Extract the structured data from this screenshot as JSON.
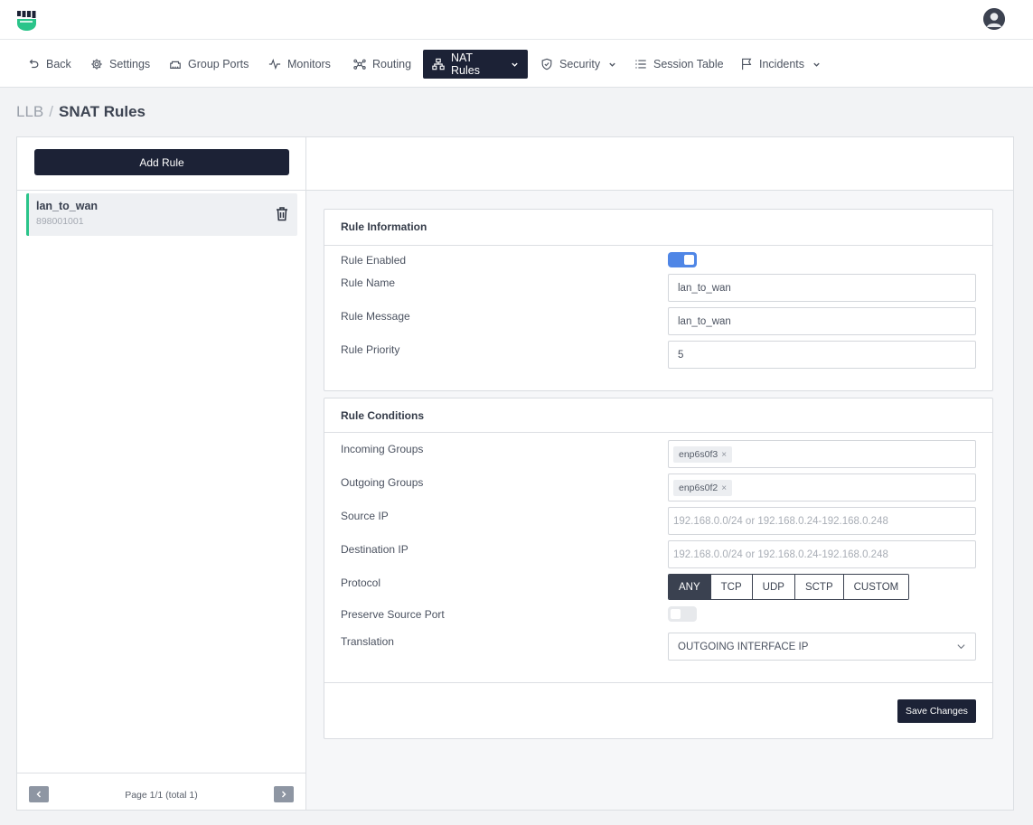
{
  "header": {
    "logo_icon": "fist-logo-icon",
    "avatar_icon": "user-avatar-icon"
  },
  "nav": {
    "back": "Back",
    "settings": "Settings",
    "group_ports": "Group Ports",
    "monitors": "Monitors",
    "routing": "Routing",
    "nat_rules": "NAT Rules",
    "security": "Security",
    "session_table": "Session Table",
    "incidents": "Incidents",
    "active": "NAT Rules"
  },
  "breadcrumb": {
    "root": "LLB",
    "separator": "/",
    "current": "SNAT Rules"
  },
  "sidebar": {
    "add_button": "Add Rule",
    "rules": [
      {
        "name": "lan_to_wan",
        "id": "898001001"
      }
    ],
    "pagination": {
      "text": "Page 1/1 (total 1)"
    }
  },
  "rule_info": {
    "title": "Rule Information",
    "enabled_label": "Rule Enabled",
    "enabled": true,
    "name_label": "Rule Name",
    "name_value": "lan_to_wan",
    "message_label": "Rule Message",
    "message_value": "lan_to_wan",
    "priority_label": "Rule Priority",
    "priority_value": "5"
  },
  "rule_conditions": {
    "title": "Rule Conditions",
    "incoming_label": "Incoming Groups",
    "incoming_tags": [
      "enp6s0f3"
    ],
    "outgoing_label": "Outgoing Groups",
    "outgoing_tags": [
      "enp6s0f2"
    ],
    "tag_remove": "×",
    "source_ip_label": "Source IP",
    "source_ip_placeholder": "192.168.0.0/24 or 192.168.0.24-192.168.0.248",
    "destination_ip_label": "Destination IP",
    "destination_ip_placeholder": "192.168.0.0/24 or 192.168.0.24-192.168.0.248",
    "protocol_label": "Protocol",
    "protocol_options": [
      "ANY",
      "TCP",
      "UDP",
      "SCTP",
      "CUSTOM"
    ],
    "protocol_selected": "ANY",
    "preserve_label": "Preserve Source Port",
    "preserve_enabled": false,
    "translation_label": "Translation",
    "translation_value": "OUTGOING INTERFACE IP"
  },
  "actions": {
    "save": "Save Changes"
  },
  "colors": {
    "primary_dark": "#1c2236",
    "accent_green": "#2bc48a",
    "toggle_on": "#4f86e6"
  }
}
